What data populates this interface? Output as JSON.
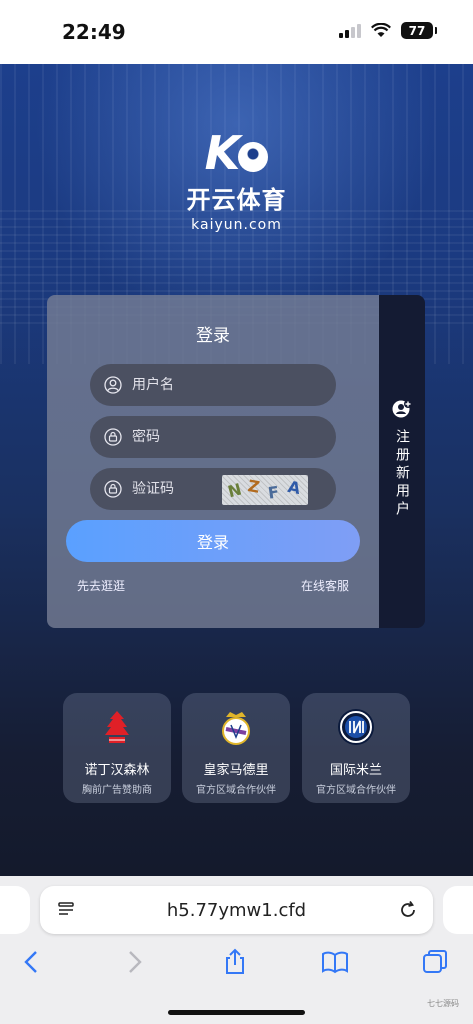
{
  "status": {
    "time": "22:49",
    "battery": "77"
  },
  "brand": {
    "cn": "开云体育",
    "en": "kaiyun.com"
  },
  "login": {
    "title": "登录",
    "username_placeholder": "用户名",
    "password_placeholder": "密码",
    "captcha_placeholder": "验证码",
    "captcha_chars": [
      "N",
      "Z",
      "F",
      "A"
    ],
    "submit": "登录",
    "browse_link": "先去逛逛",
    "support_link": "在线客服",
    "register_tab": "注册新用户"
  },
  "partners": [
    {
      "name": "诺丁汉森林",
      "subtitle": "胸前广告赞助商"
    },
    {
      "name": "皇家马德里",
      "subtitle": "官方区域合作伙伴"
    },
    {
      "name": "国际米兰",
      "subtitle": "官方区域合作伙伴"
    }
  ],
  "browser": {
    "url": "h5.77ymw1.cfd"
  },
  "watermark": "七七源码",
  "colors": {
    "accent": "#5aa0ff",
    "card": "#787f96",
    "tab": "#141b33"
  }
}
